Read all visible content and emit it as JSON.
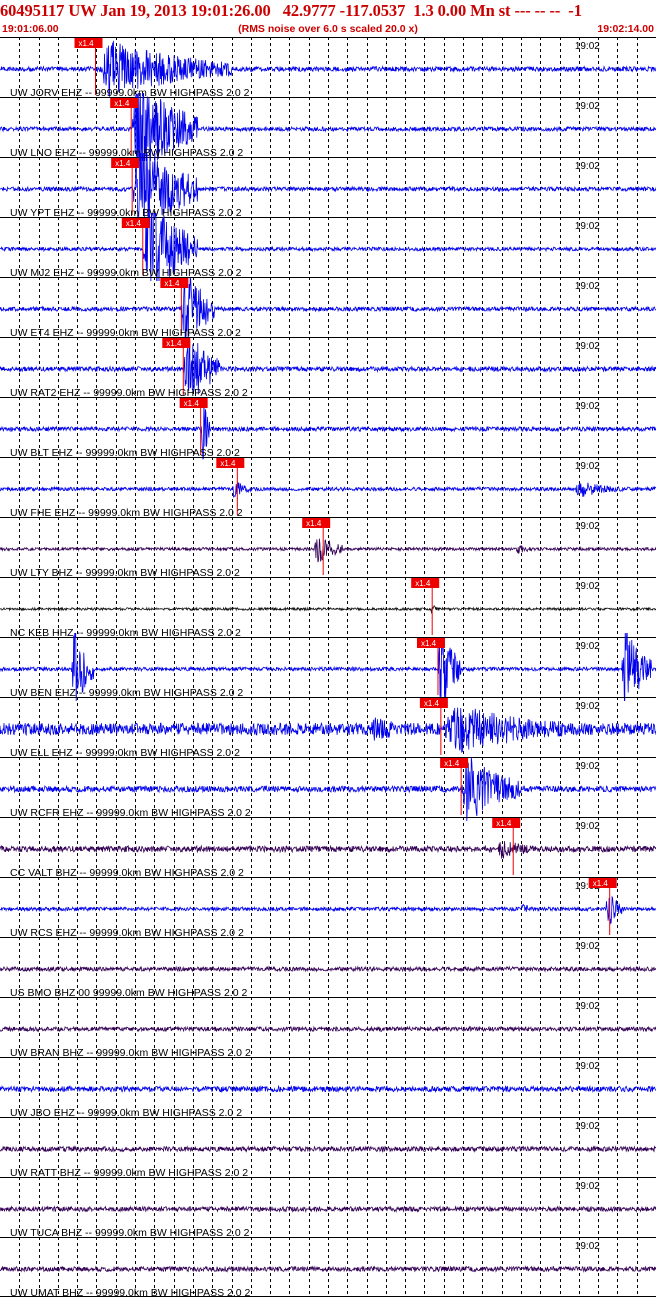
{
  "header": {
    "title": "60495117 UW Jan 19, 2013 19:01:26.00   42.9777 -117.0537  1.3 0.00 Mn st --- -- --  -1",
    "start_time": "19:01:06.00",
    "rms_note": "(RMS noise over 6.0 s scaled 20.0 x)",
    "end_time": "19:02:14.00"
  },
  "colors": {
    "header_red": "#cc0000",
    "trace_blue": "#0000ee",
    "trace_purple": "#330055",
    "trace_black": "#111111",
    "pick_red": "#ee0000",
    "grid": "#000000"
  },
  "chart_data": {
    "type": "seismogram-record-section",
    "x_range": [
      "19:01:06.00",
      "19:02:14.00"
    ],
    "x_range_seconds": [
      0,
      68
    ],
    "tick_label": "19:02",
    "pick_label": "x1.4",
    "grid": "vertical dashed lines at 2 s intervals",
    "traces": [
      {
        "label": "UW JORV EHZ -- 99999.0km BW  HIGHPASS  2.0  2",
        "color": "trace_blue",
        "pick_s": 9.9,
        "bursts": [
          [
            10.0,
            24.0,
            1.0
          ]
        ],
        "noise": 0.08
      },
      {
        "label": "UW LNO EHZ -- 99999.0km BW  HIGHPASS  2.0  2",
        "color": "trace_blue",
        "pick_s": 13.6,
        "bursts": [
          [
            13.6,
            20.5,
            1.8
          ]
        ],
        "noise": 0.07
      },
      {
        "label": "UW YPT EHZ -- 99999.0km BW  HIGHPASS  2.0  2",
        "color": "trace_blue",
        "pick_s": 13.7,
        "bursts": [
          [
            13.7,
            20.5,
            1.8
          ]
        ],
        "noise": 0.07
      },
      {
        "label": "UW MJ2 EHZ -- 99999.0km BW  HIGHPASS  2.0  2",
        "color": "trace_blue",
        "pick_s": 14.8,
        "bursts": [
          [
            14.8,
            20.5,
            1.8
          ]
        ],
        "noise": 0.06
      },
      {
        "label": "UW ET4 EHZ -- 99999.0km BW  HIGHPASS  2.0  2",
        "color": "trace_blue",
        "pick_s": 18.8,
        "bursts": [
          [
            18.8,
            22.2,
            1.5
          ]
        ],
        "noise": 0.07
      },
      {
        "label": "UW RAT2 EHZ -- 99999.0km BW  HIGHPASS  2.0  2",
        "color": "trace_blue",
        "pick_s": 19.0,
        "bursts": [
          [
            19.0,
            22.8,
            1.5
          ]
        ],
        "noise": 0.08
      },
      {
        "label": "UW BLT EHZ -- 99999.0km BW  HIGHPASS  2.0  2",
        "color": "trace_blue",
        "pick_s": 20.8,
        "bursts": [
          [
            20.8,
            21.8,
            1.4
          ]
        ],
        "noise": 0.07
      },
      {
        "label": "UW FHE EHZ -- 99999.0km BW  HIGHPASS  2.0  2",
        "color": "trace_blue",
        "pick_s": 24.6,
        "bursts": [
          [
            24.0,
            26.0,
            0.35
          ],
          [
            59.5,
            64.5,
            0.3
          ]
        ],
        "noise": 0.06
      },
      {
        "label": "UW LTY BHZ -- 99999.0km BW  HIGHPASS  2.0  2",
        "color": "trace_purple",
        "pick_s": 33.5,
        "bursts": [
          [
            32.5,
            35.5,
            0.6
          ],
          [
            53.5,
            55.0,
            0.25
          ]
        ],
        "noise": 0.05
      },
      {
        "label": "NC KEB HHZ -- 99999.0km BW  HIGHPASS  2.0  2",
        "color": "trace_black",
        "pick_s": 44.8,
        "bursts": [
          [
            44.6,
            45.5,
            0.2
          ]
        ],
        "noise": 0.04
      },
      {
        "label": "UW BEN EHZ -- 99999.0km BW  HIGHPASS  2.0  2",
        "color": "trace_blue",
        "pick_s": 45.4,
        "bursts": [
          [
            7.4,
            9.7,
            1.5
          ],
          [
            45.4,
            47.8,
            1.5
          ],
          [
            64.4,
            67.5,
            1.5
          ]
        ],
        "noise": 0.06
      },
      {
        "label": "UW ELL EHZ -- 99999.0km BW  HIGHPASS  2.0  2",
        "color": "trace_blue",
        "pick_s": 45.7,
        "bursts": [
          [
            38.0,
            45.7,
            0.4
          ],
          [
            45.7,
            59.5,
            0.9
          ]
        ],
        "noise": 0.2
      },
      {
        "label": "UW RCFR EHZ -- 99999.0km BW  HIGHPASS  2.0  2",
        "color": "trace_blue",
        "pick_s": 47.8,
        "bursts": [
          [
            47.8,
            54.0,
            1.2
          ]
        ],
        "noise": 0.1
      },
      {
        "label": "CC VALT BHZ -- 99999.0km BW  HIGHPASS  2.0  2",
        "color": "trace_purple",
        "pick_s": 53.2,
        "bursts": [
          [
            51.5,
            56.0,
            0.35
          ]
        ],
        "noise": 0.1
      },
      {
        "label": "UW RCS EHZ -- 99999.0km BW  HIGHPASS  2.0  2",
        "color": "trace_blue",
        "pick_s": 63.2,
        "bursts": [
          [
            62.8,
            64.5,
            0.7
          ],
          [
            54.0,
            55.5,
            0.2
          ]
        ],
        "noise": 0.06
      },
      {
        "label": "US BMO BHZ 00 99999.0km BW  HIGHPASS  2.0  2",
        "color": "trace_purple",
        "pick_s": null,
        "bursts": [],
        "noise": 0.07
      },
      {
        "label": "UW BRAN BHZ -- 99999.0km BW  HIGHPASS  2.0  2",
        "color": "trace_purple",
        "pick_s": null,
        "bursts": [
          [
            39.0,
            41.0,
            0.12
          ]
        ],
        "noise": 0.07
      },
      {
        "label": "UW JBO EHZ -- 99999.0km BW  HIGHPASS  2.0  2",
        "color": "trace_blue",
        "pick_s": null,
        "bursts": [],
        "noise": 0.09
      },
      {
        "label": "UW RATT BHZ -- 99999.0km BW  HIGHPASS  2.0  2",
        "color": "trace_purple",
        "pick_s": null,
        "bursts": [],
        "noise": 0.08
      },
      {
        "label": "UW TUCA BHZ -- 99999.0km BW  HIGHPASS  2.0  2",
        "color": "trace_purple",
        "pick_s": null,
        "bursts": [],
        "noise": 0.08
      },
      {
        "label": "UW UMAT BHZ -- 99999.0km BW  HIGHPASS  2.0  2",
        "color": "trace_purple",
        "pick_s": null,
        "bursts": [],
        "noise": 0.08
      }
    ]
  }
}
